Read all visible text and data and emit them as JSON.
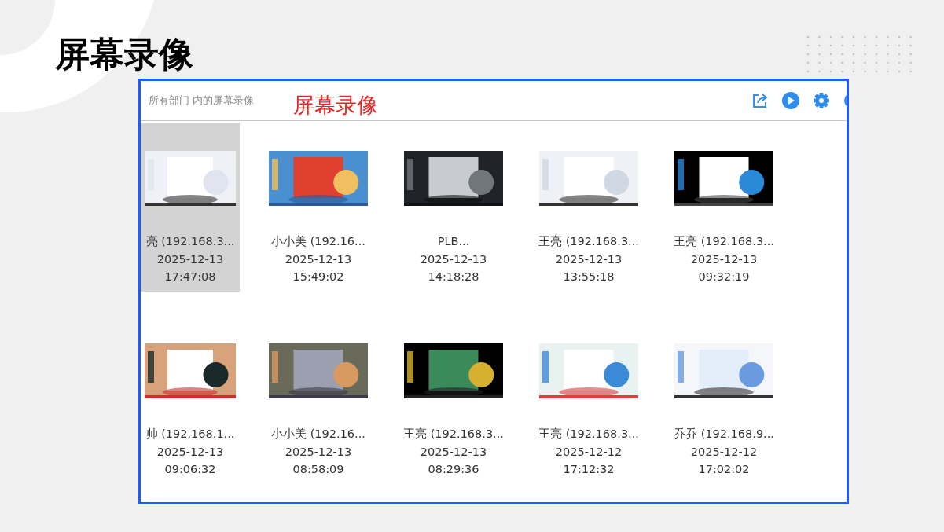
{
  "slide_title": "屏幕录像",
  "app": {
    "breadcrumb": "所有部门 内的屏幕录像",
    "annotation": "屏幕录像",
    "recordings": [
      {
        "name": "亮 (192.168.3...",
        "date": "2025-12-13",
        "time": "17:47:08",
        "selected": true
      },
      {
        "name": "小小美 (192.16...",
        "date": "2025-12-13",
        "time": "15:49:02",
        "selected": false
      },
      {
        "name": "PLB...",
        "date": "2025-12-13",
        "time": "14:18:28",
        "selected": false
      },
      {
        "name": "王亮 (192.168.3...",
        "date": "2025-12-13",
        "time": "13:55:18",
        "selected": false
      },
      {
        "name": "王亮 (192.168.3...",
        "date": "2025-12-13",
        "time": "09:32:19",
        "selected": false
      },
      {
        "name": "帅 (192.168.1...",
        "date": "2025-12-13",
        "time": "09:06:32",
        "selected": false
      },
      {
        "name": "小小美 (192.16...",
        "date": "2025-12-13",
        "time": "08:58:09",
        "selected": false
      },
      {
        "name": "王亮 (192.168.3...",
        "date": "2025-12-13",
        "time": "08:29:36",
        "selected": false
      },
      {
        "name": "王亮 (192.168.3...",
        "date": "2025-12-12",
        "time": "17:12:32",
        "selected": false
      },
      {
        "name": "乔乔 (192.168.9...",
        "date": "2025-12-12",
        "time": "17:02:02",
        "selected": false
      }
    ]
  }
}
